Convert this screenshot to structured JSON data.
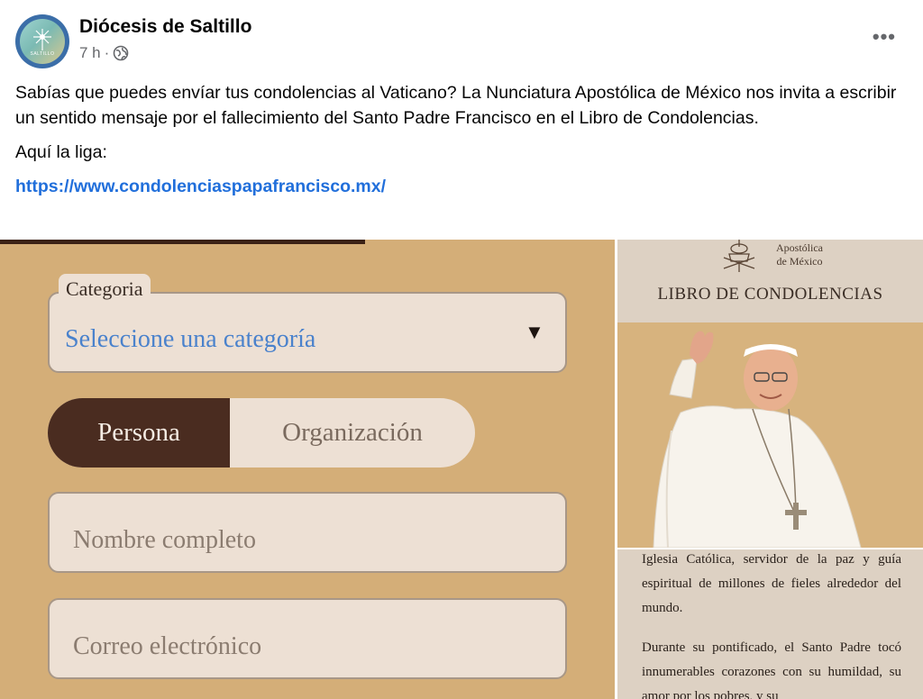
{
  "post": {
    "page_name": "Diócesis de Saltillo",
    "time": "7 h",
    "separator": "·",
    "more": "•••",
    "avatar_text": "SALTILLO",
    "paragraph1": "Sabías que puedes envíar tus condolencias al Vaticano? La Nunciatura Apostólica de México nos invita a escribir un sentido mensaje por el fallecimiento del Santo Padre Francisco en el Libro de Condolencias.",
    "paragraph2": "Aquí la liga:",
    "link": "https://www.condolenciaspapafrancisco.mx/"
  },
  "form": {
    "category_legend": "Categoria",
    "category_value": "Seleccione una categoría",
    "category_arrow": "▼",
    "toggle_selected": "Persona",
    "toggle_other": "Organización",
    "name_placeholder": "Nombre completo",
    "email_placeholder": "Correo electrónico"
  },
  "book": {
    "apostolica_line1": "Apostólica",
    "apostolica_line2": "de México",
    "title": "LIBRO DE CONDOLENCIAS",
    "text1": "Iglesia Católica, servidor de la paz y guía espiritual de millones de fieles alrededor del mundo.",
    "text2": "Durante su pontificado, el Santo Padre tocó innumerables corazones con su humildad, su amor por los pobres, y su"
  },
  "colors": {
    "link": "#216fdb",
    "form_bg": "#d4ae78",
    "toggle_active": "#4a2c20",
    "field_bg": "#ede0d4",
    "select_text": "#4a82cc"
  },
  "icons": [
    "globe-icon",
    "more-options-icon",
    "dropdown-arrow-icon",
    "crest-icon"
  ]
}
